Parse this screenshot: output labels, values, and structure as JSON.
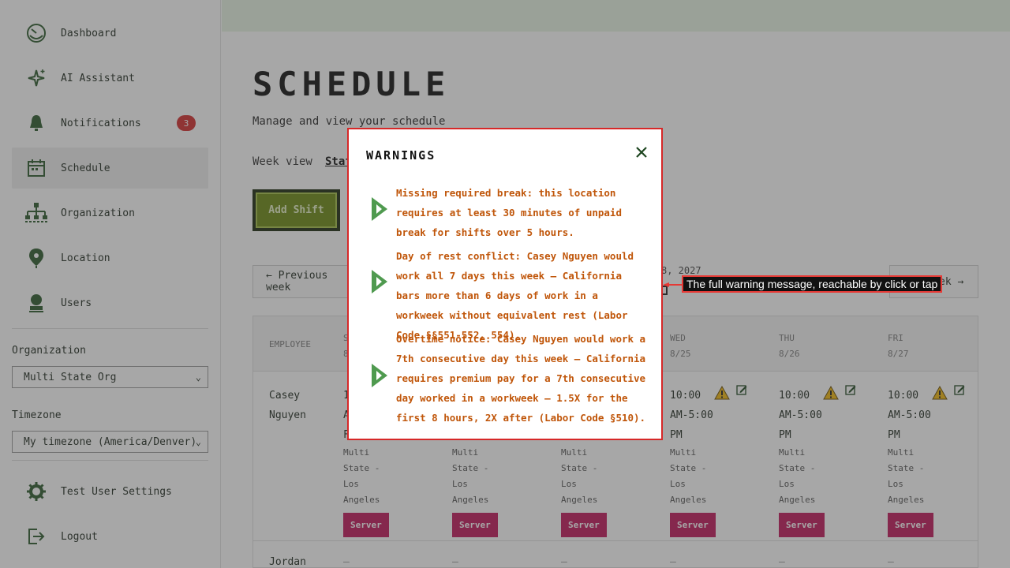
{
  "sidebar": {
    "items": [
      {
        "label": "Dashboard",
        "icon": "dashboard-icon"
      },
      {
        "label": "AI Assistant",
        "icon": "sparkle-icon"
      },
      {
        "label": "Notifications",
        "icon": "bell-icon",
        "badge": "3"
      },
      {
        "label": "Schedule",
        "icon": "calendar-icon",
        "active": true
      },
      {
        "label": "Organization",
        "icon": "org-chart-icon"
      },
      {
        "label": "Location",
        "icon": "location-pin-icon"
      },
      {
        "label": "Users",
        "icon": "user-icon"
      }
    ],
    "organization_label": "Organization",
    "organization_value": "Multi State Org",
    "timezone_label": "Timezone",
    "timezone_value": "My timezone (America/Denver)",
    "settings_label": "Test User Settings",
    "logout_label": "Logout"
  },
  "main": {
    "title": "SCHEDULE",
    "subtitle": "Manage and view your schedule",
    "week_view_label": "Week view",
    "staff_link": "Staf",
    "add_shift_label": "Add Shift",
    "prev_week_label": "← Previous week",
    "next_week_label": "ek →",
    "date_fragment": "8, 2027",
    "table": {
      "headers": [
        {
          "day": "EMPLOYEE",
          "date": ""
        },
        {
          "day": "S",
          "date": "8"
        },
        {
          "day": "WED",
          "date": "8/25"
        },
        {
          "day": "THU",
          "date": "8/26"
        },
        {
          "day": "FRI",
          "date": "8/27"
        }
      ],
      "employee": {
        "first": "Casey",
        "last": "Nguyen"
      },
      "partial_cell": {
        "l1": "1",
        "l2": "A",
        "l3": "F"
      },
      "full_cell": {
        "time1": "10:00",
        "time2": "AM-5:00",
        "time3": "PM"
      },
      "location_lines": [
        "Multi",
        "State -",
        "Los",
        "Angeles"
      ],
      "role": "Server",
      "second_employee": "Jordan",
      "empty_dash": "—"
    }
  },
  "modal": {
    "title": "WARNINGS",
    "warnings": [
      "Missing required break: this location requires at least 30 minutes of unpaid break for shifts over 5 hours.",
      "Day of rest conflict: Casey Nguyen would work all 7 days this week — California bars more than 6 days of work in a workweek without equivalent rest (Labor Code §§551-552, 554).",
      "Overtime notice: Casey Nguyen would work a 7th consecutive day this week — California requires premium pay for a 7th consecutive day worked in a workweek — 1.5X for the first 8 hours, 2X after (Labor Code §510)."
    ]
  },
  "callout": "The full warning message, reachable by click or tap",
  "colors": {
    "accent_green": "#2e5b2e",
    "warning_text": "#c0560a",
    "modal_border": "#d62828",
    "role_badge": "#c2185b",
    "notification_badge": "#d32f2f"
  }
}
